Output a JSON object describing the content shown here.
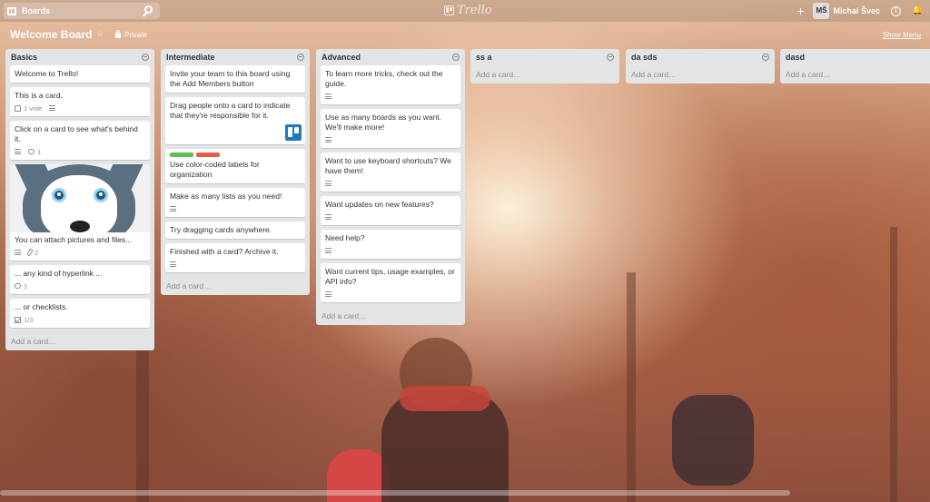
{
  "header": {
    "boards_label": "Boards",
    "logo_text": "Trello",
    "plus_label": "+",
    "avatar_initials": "MŠ",
    "user_name": "Michal Švec"
  },
  "board": {
    "title": "Welcome Board",
    "privacy": "Private",
    "show_menu": "Show Menu"
  },
  "lists": [
    {
      "title": "Basics",
      "add_card": "Add a card…",
      "cards": [
        {
          "text": "Welcome to Trello!"
        },
        {
          "text": "This is a card.",
          "votes": "1 vote",
          "desc": true
        },
        {
          "text": "Click on a card to see what's behind it.",
          "desc": true,
          "comments": "1"
        },
        {
          "text": "You can attach pictures and files...",
          "image": "husky",
          "desc": true,
          "attachments": "2"
        },
        {
          "text": "... any kind of hyperlink ...",
          "comments": "1"
        },
        {
          "text": "... or checklists.",
          "checklist": "1/3"
        }
      ]
    },
    {
      "title": "Intermediate",
      "add_card": "Add a card…",
      "cards": [
        {
          "text": "Invite your team to this board using the Add Members button"
        },
        {
          "text": "Drag people onto a card to indicate that they're responsible for it.",
          "member_thumb": true
        },
        {
          "text": "Use color-coded labels for organization",
          "labels": [
            "#61bd4f",
            "#eb5a46"
          ]
        },
        {
          "text": "Make as many lists as you need!",
          "desc": true
        },
        {
          "text": "Try dragging cards anywhere."
        },
        {
          "text": "Finished with a card? Archive it.",
          "desc": true
        }
      ]
    },
    {
      "title": "Advanced",
      "add_card": "Add a card…",
      "cards": [
        {
          "text": "To learn more tricks, check out the guide.",
          "desc": true
        },
        {
          "text": "Use as many boards as you want. We'll make more!",
          "desc": true
        },
        {
          "text": "Want to use keyboard shortcuts? We have them!",
          "desc": true
        },
        {
          "text": "Want updates on new features?",
          "desc": true
        },
        {
          "text": "Need help?",
          "desc": true
        },
        {
          "text": "Want current tips, usage examples, or API info?",
          "desc": true
        }
      ]
    },
    {
      "title": "ss a",
      "add_card": "Add a card…",
      "cards": []
    },
    {
      "title": "da sds",
      "add_card": "Add a card…",
      "cards": []
    },
    {
      "title": "dasd",
      "add_card": "Add a card…",
      "cards": []
    }
  ]
}
